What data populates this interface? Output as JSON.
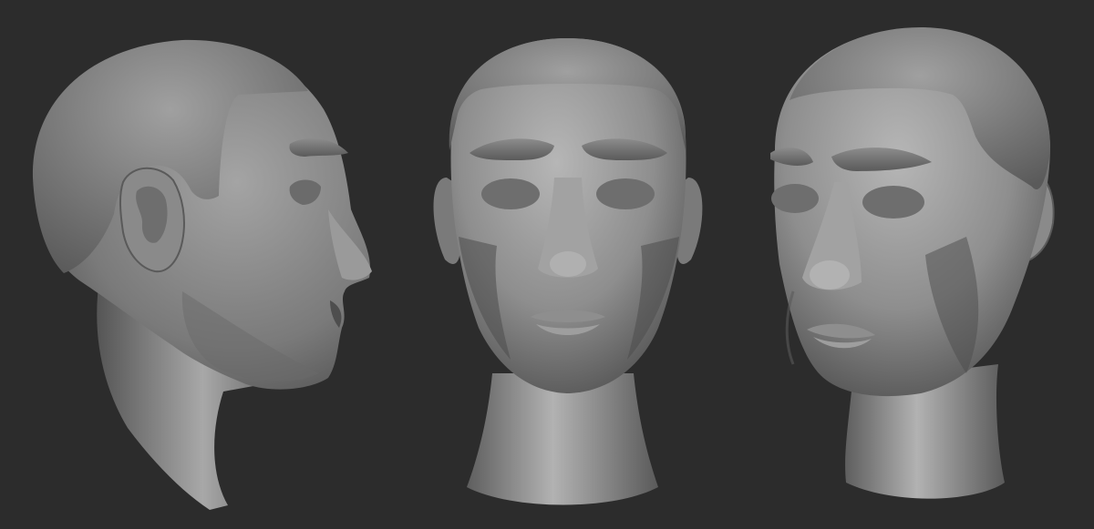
{
  "scene": {
    "background_color": "#2c2c2c",
    "material_color": "#8a8a8a",
    "views": [
      {
        "name": "side-profile-view"
      },
      {
        "name": "front-view"
      },
      {
        "name": "three-quarter-view"
      }
    ]
  }
}
